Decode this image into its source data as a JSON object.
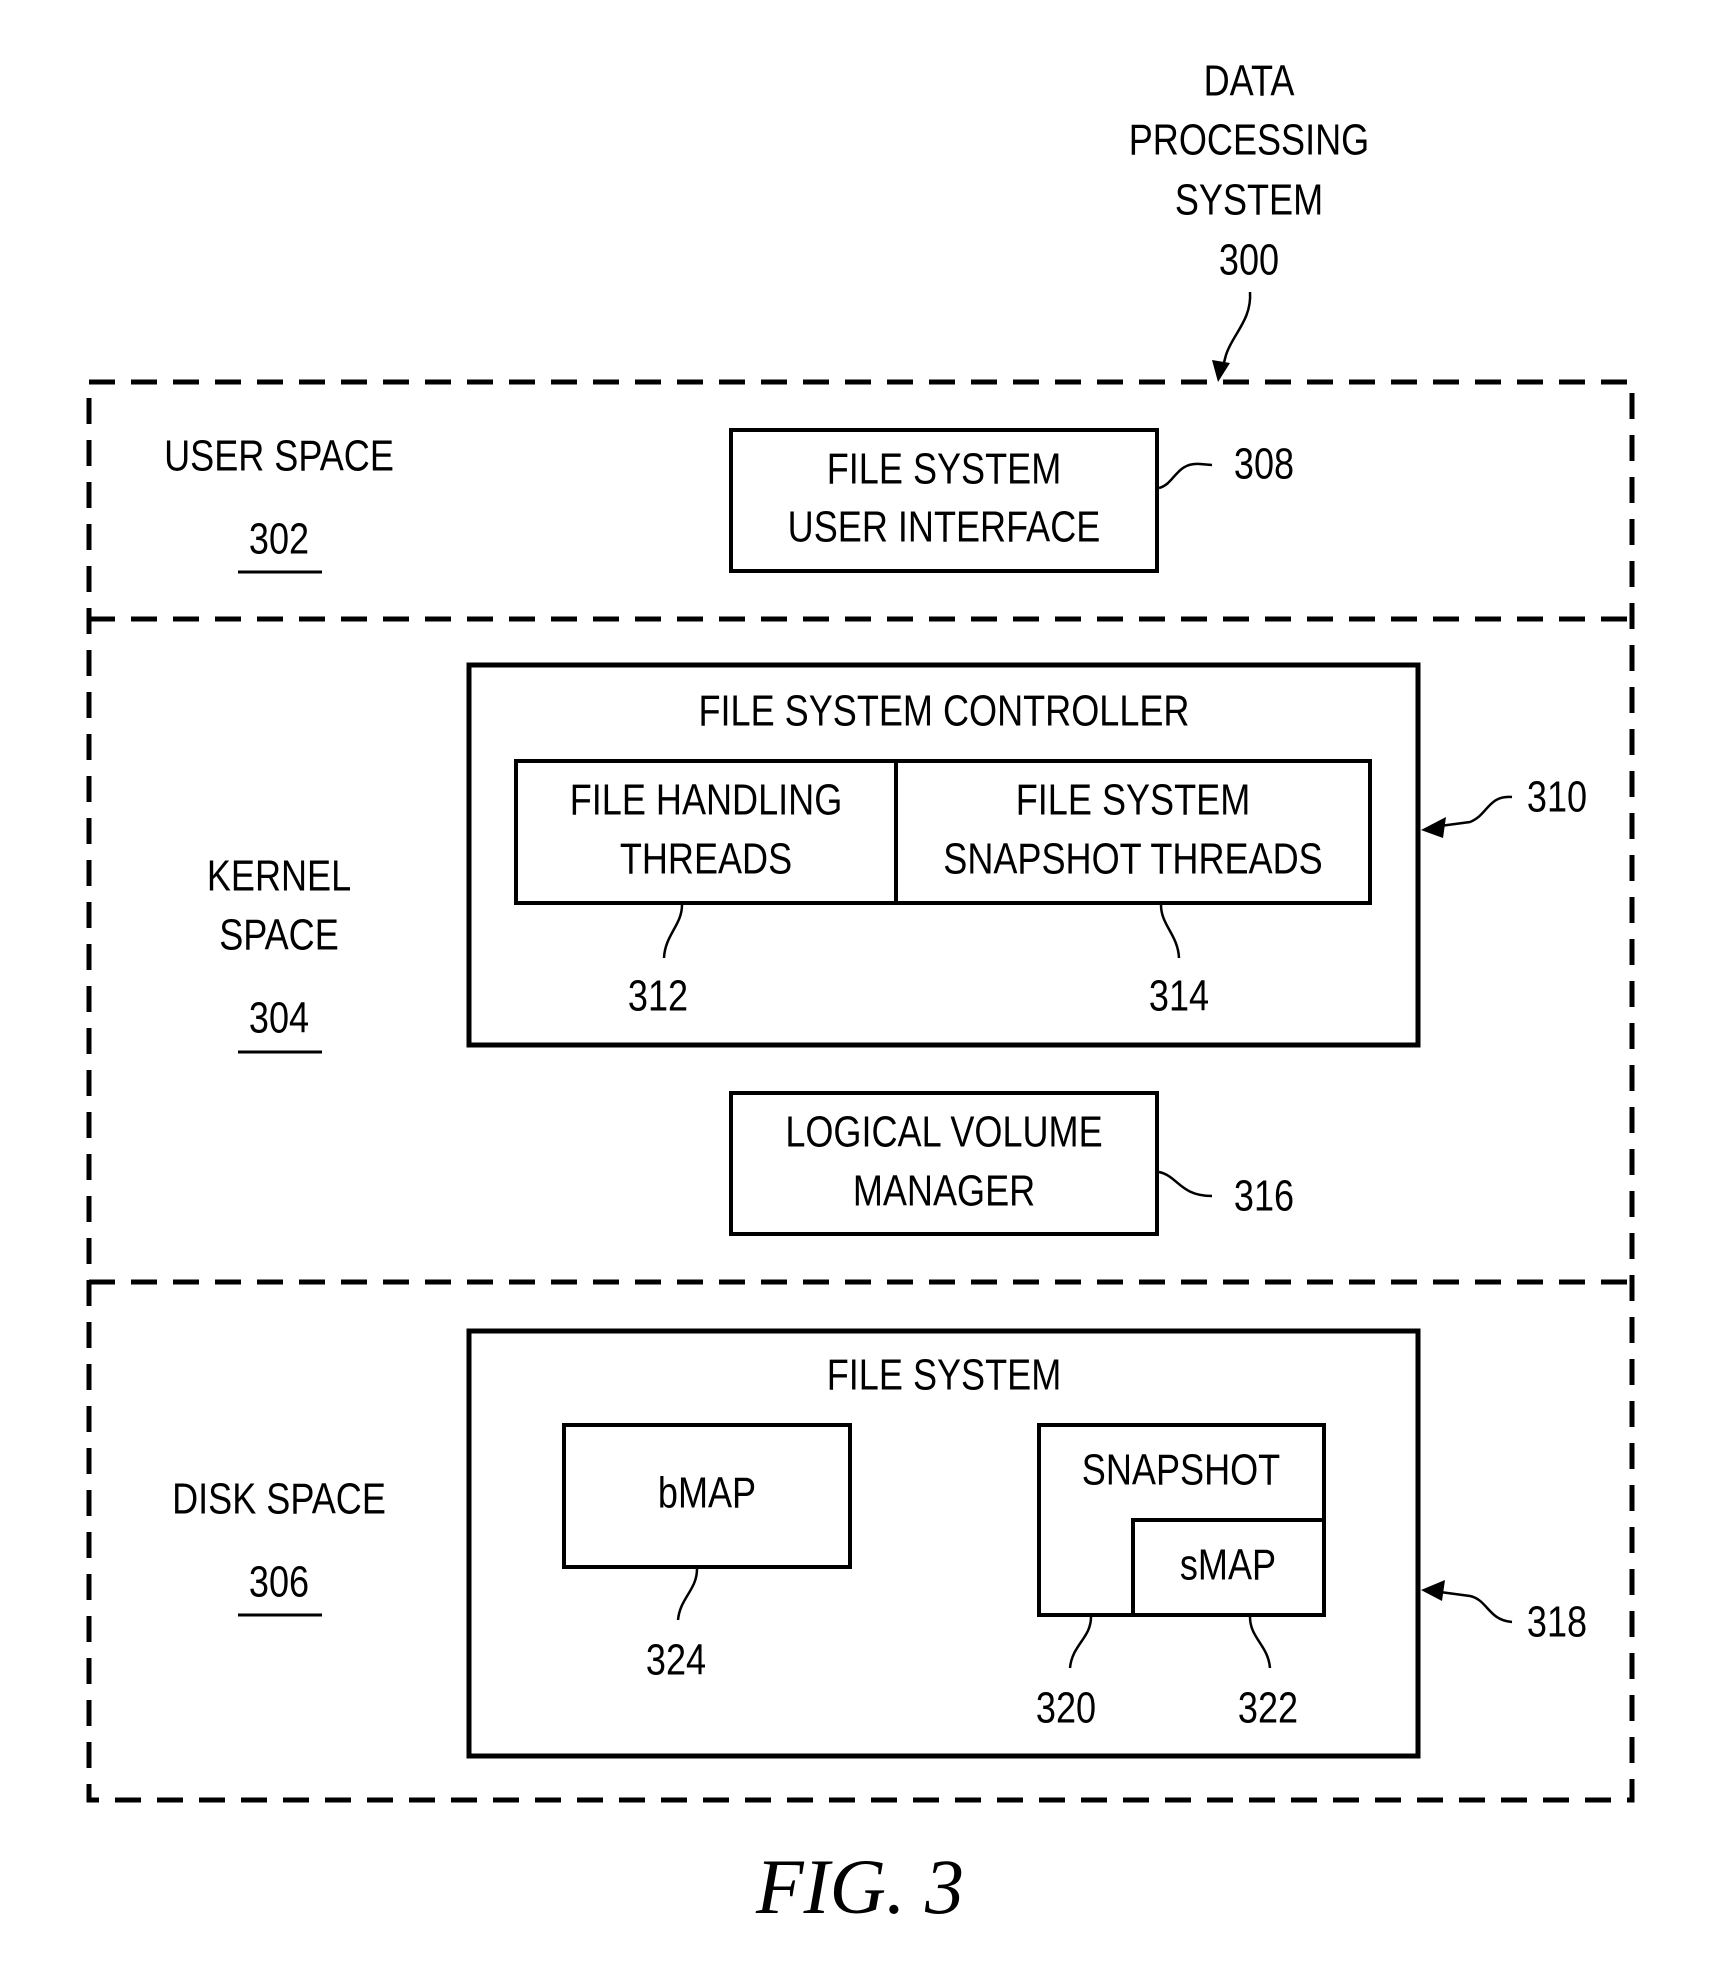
{
  "figure": {
    "caption": "FIG. 3",
    "system": {
      "title_lines": [
        "DATA",
        "PROCESSING",
        "SYSTEM"
      ],
      "ref": "300"
    },
    "regions": [
      {
        "id": "user-space",
        "label_lines": [
          "USER SPACE"
        ],
        "ref": "302"
      },
      {
        "id": "kernel-space",
        "label_lines": [
          "KERNEL",
          "SPACE"
        ],
        "ref": "304"
      },
      {
        "id": "disk-space",
        "label_lines": [
          "DISK SPACE"
        ],
        "ref": "306"
      }
    ],
    "components": {
      "fs_user_interface": {
        "lines": [
          "FILE SYSTEM",
          "USER INTERFACE"
        ],
        "ref": "308"
      },
      "fs_controller": {
        "title": "FILE SYSTEM CONTROLLER",
        "ref": "310"
      },
      "file_handling_threads": {
        "lines": [
          "FILE HANDLING",
          "THREADS"
        ],
        "ref": "312"
      },
      "fs_snapshot_threads": {
        "lines": [
          "FILE SYSTEM",
          "SNAPSHOT THREADS"
        ],
        "ref": "314"
      },
      "logical_volume_manager": {
        "lines": [
          "LOGICAL VOLUME",
          "MANAGER"
        ],
        "ref": "316"
      },
      "file_system": {
        "title": "FILE SYSTEM",
        "ref": "318"
      },
      "snapshot": {
        "label": "SNAPSHOT",
        "ref": "320"
      },
      "smap": {
        "label": "sMAP",
        "ref": "322"
      },
      "bmap": {
        "label": "bMAP",
        "ref": "324"
      }
    }
  }
}
